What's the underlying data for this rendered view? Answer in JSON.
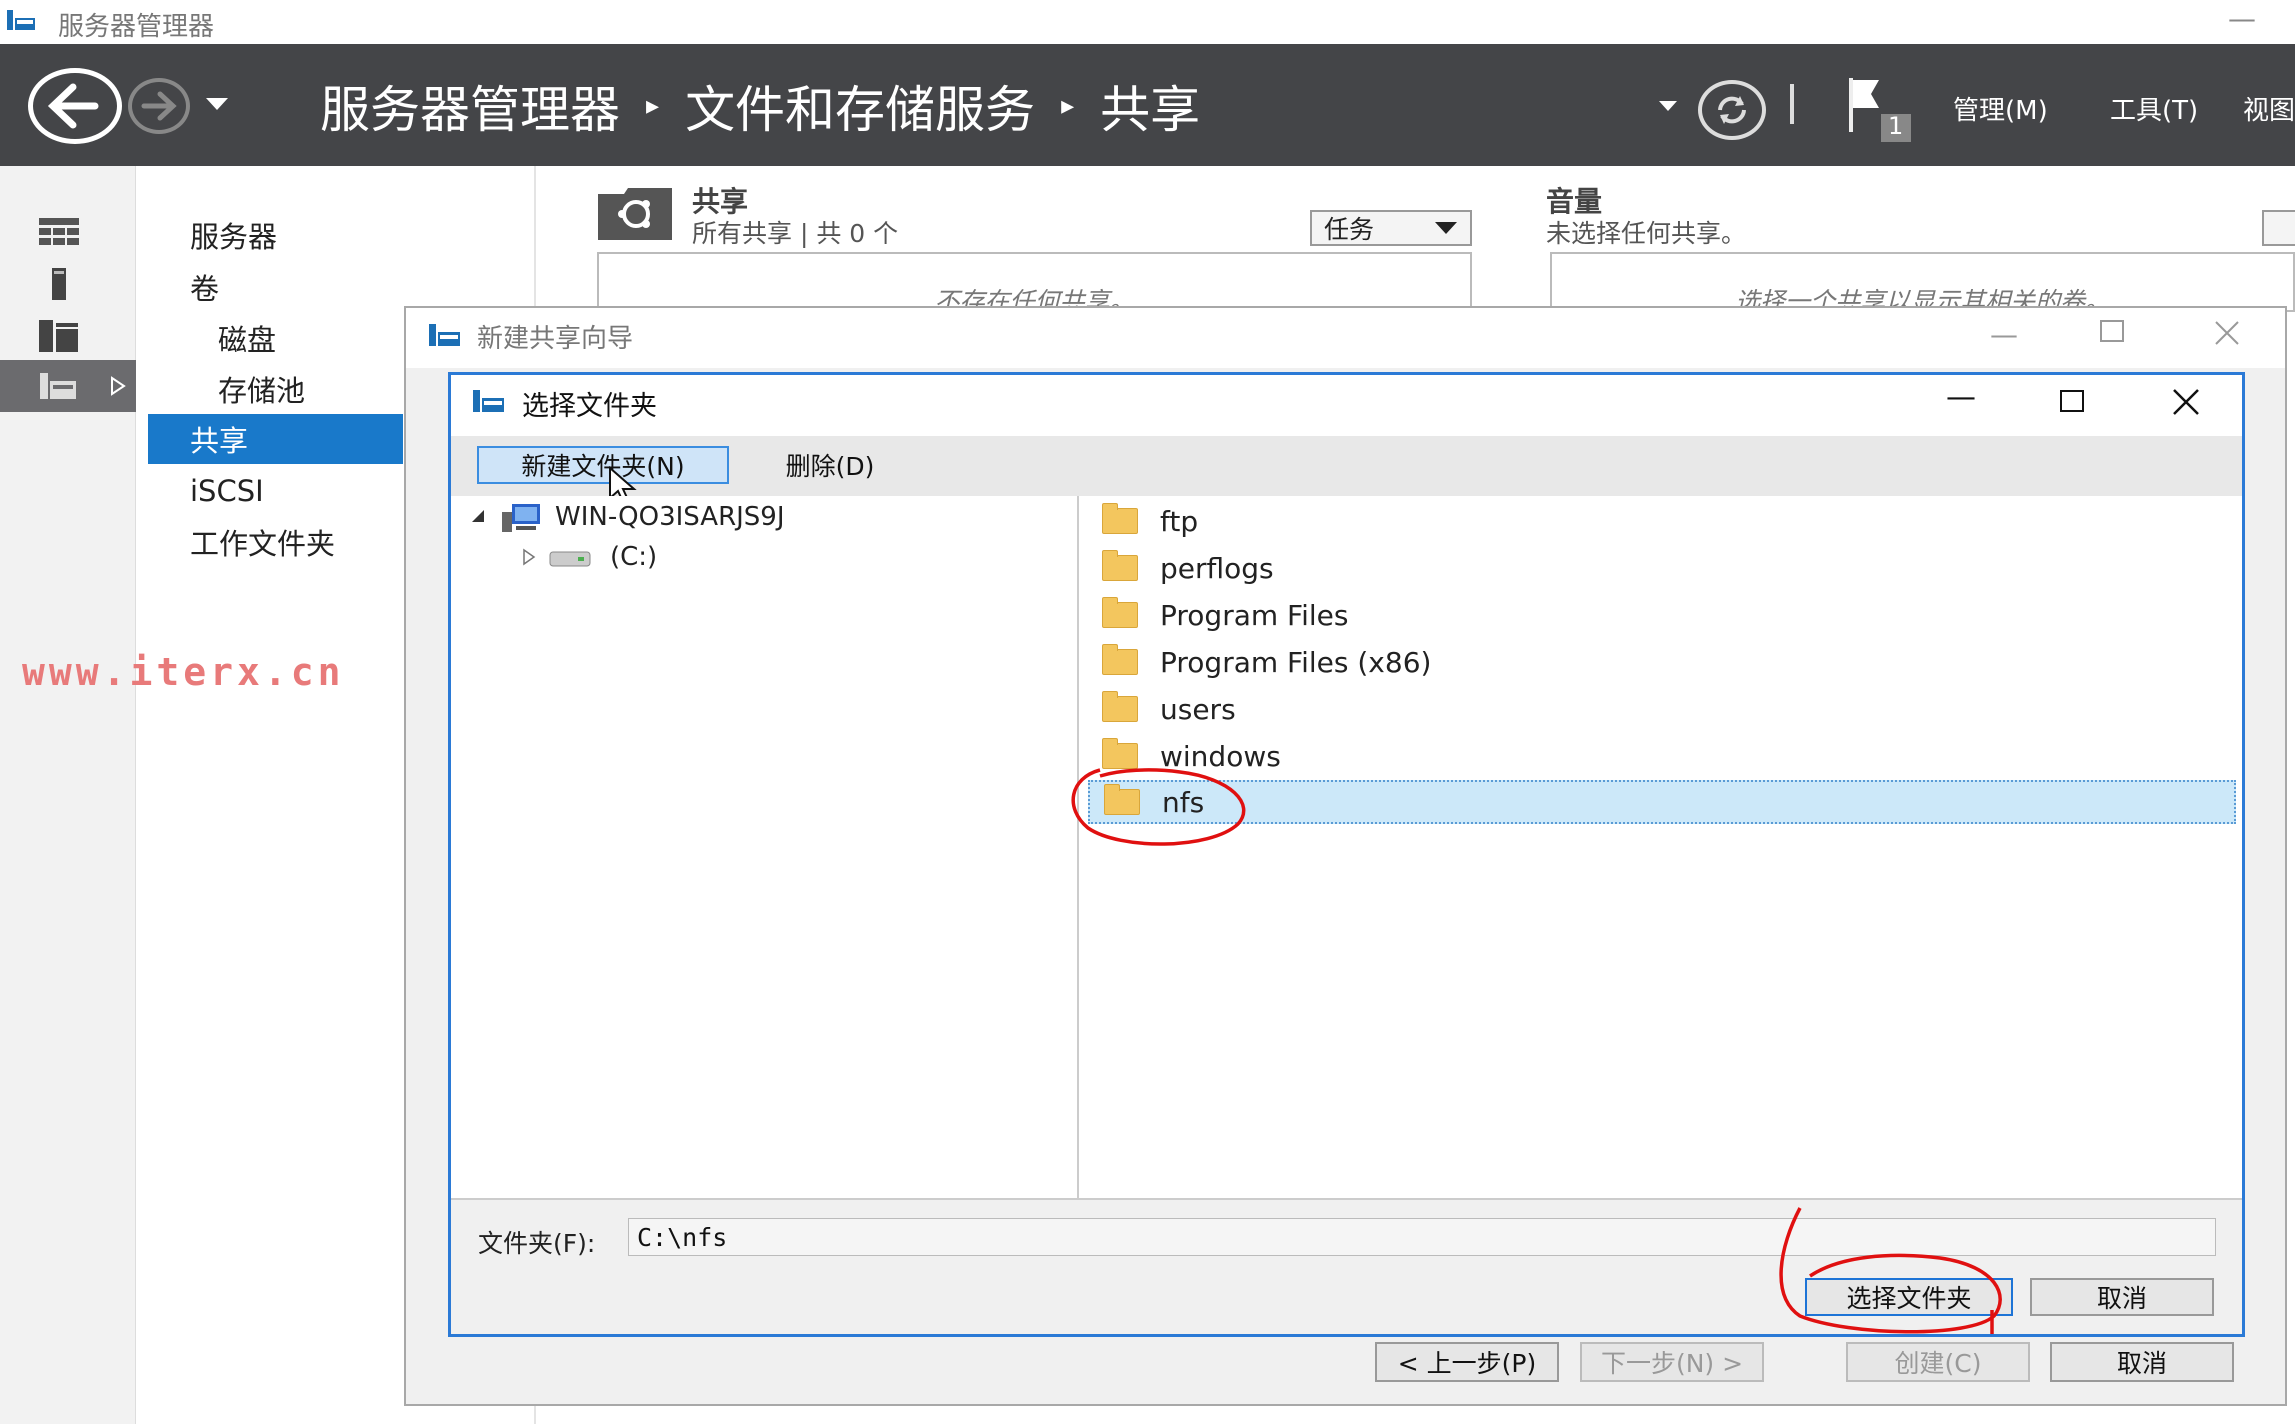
{
  "window": {
    "title": "服务器管理器"
  },
  "header": {
    "breadcrumbs": [
      "服务器管理器",
      "文件和存储服务",
      "共享"
    ],
    "notification_count": "1",
    "menus": {
      "manage": "管理(M)",
      "tools": "工具(T)",
      "view": "视图"
    }
  },
  "nav": {
    "items": [
      {
        "label": "服务器"
      },
      {
        "label": "卷"
      },
      {
        "label": "磁盘"
      },
      {
        "label": "存储池"
      },
      {
        "label": "共享"
      },
      {
        "label": "iSCSI"
      },
      {
        "label": "工作文件夹"
      }
    ],
    "selected": "共享"
  },
  "shares_panel": {
    "title": "共享",
    "subtitle": "所有共享 | 共 0 个",
    "tasks_label": "任务",
    "empty_text": "不存在任何共享。"
  },
  "volume_panel": {
    "title": "音量",
    "subtitle": "未选择任何共享。",
    "empty_text": "选择一个共享以显示其相关的卷。"
  },
  "watermark": "www.iterx.cn",
  "wizard": {
    "title": "新建共享向导",
    "buttons": {
      "prev": "< 上一步(P)",
      "next": "下一步(N) >",
      "create": "创建(C)",
      "cancel": "取消"
    }
  },
  "dialog": {
    "title": "选择文件夹",
    "toolbar": {
      "new_folder": "新建文件夹(N)",
      "delete": "删除(D)"
    },
    "tree": {
      "computer": "WIN-QO3ISARJS9J",
      "drive": "(C:)"
    },
    "folders": [
      "ftp",
      "perflogs",
      "Program Files",
      "Program Files (x86)",
      "users",
      "windows",
      "nfs"
    ],
    "selected_folder": "nfs",
    "folder_label": "文件夹(F):",
    "folder_value": "C:\\nfs",
    "buttons": {
      "select": "选择文件夹",
      "cancel": "取消"
    }
  },
  "colors": {
    "header": "#444548",
    "accent": "#1979ca",
    "selection": "#cce8f9",
    "annotation": "#e01010"
  }
}
